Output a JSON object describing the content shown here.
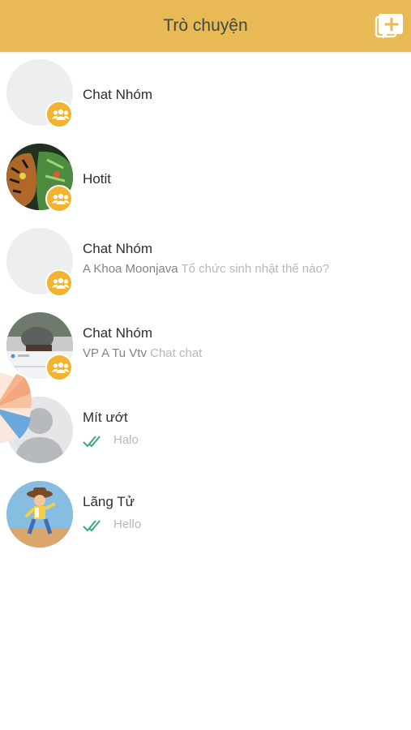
{
  "header": {
    "title": "Trò chuyện",
    "compose_icon": "compose-chat-icon"
  },
  "colors": {
    "header_bg": "#e9b955",
    "badge": "#f2b430",
    "read_tick": "#3aa876"
  },
  "conversations": [
    {
      "name": "Chat Nhóm",
      "sender": "",
      "preview": "",
      "group": true,
      "avatar": "blank"
    },
    {
      "name": "Hotit",
      "sender": "",
      "preview": "",
      "group": true,
      "avatar": "tiger-photo"
    },
    {
      "name": "Chat Nhóm",
      "sender": "A Khoa Moonjava",
      "preview": "Tổ chức sinh nhật thế nào?",
      "group": true,
      "avatar": "blank"
    },
    {
      "name": "Chat Nhóm",
      "sender": "VP A Tu Vtv",
      "preview": "Chat chat",
      "group": true,
      "avatar": "teapot-photo"
    },
    {
      "name": "Mít ướt",
      "sender": "",
      "preview": "Halo",
      "group": false,
      "read": true,
      "avatar": "default-person"
    },
    {
      "name": "Lãng Tử",
      "sender": "",
      "preview": "Hello",
      "group": false,
      "read": true,
      "avatar": "cowboy-photo"
    }
  ]
}
